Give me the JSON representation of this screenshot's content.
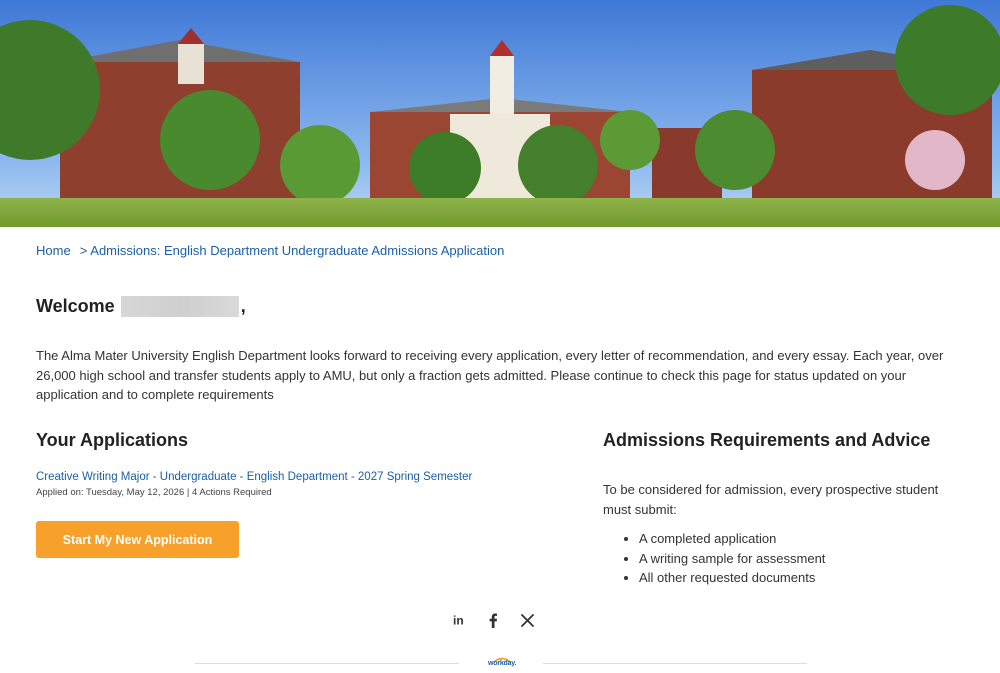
{
  "hero": {
    "image_alt": "campus-buildings-photo"
  },
  "breadcrumb": {
    "home": "Home",
    "separator": ">",
    "current": "Admissions: English Department Undergraduate Admissions Application"
  },
  "welcome": {
    "prefix": "Welcome",
    "suffix": ","
  },
  "intro": "The Alma Mater University English Department looks forward to receiving every application, every letter of recommendation, and every essay. Each year, over 26,000 high school and transfer students apply to AMU, but only a fraction gets admitted. Please continue to check this page for status updated on your application and to complete requirements",
  "applications": {
    "title": "Your Applications",
    "items": [
      {
        "name": "Creative Writing Major - Undergraduate - English Department - 2027 Spring Semester",
        "meta": "Applied on: Tuesday, May 12, 2026 | 4 Actions Required"
      }
    ],
    "start_button": "Start My New Application"
  },
  "requirements": {
    "title": "Admissions Requirements and Advice",
    "intro": "To be considered for admission, every prospective student must submit:",
    "items": [
      "A completed application",
      "A writing sample for assessment",
      "All other requested documents"
    ]
  },
  "footer": {
    "social": [
      "linkedin-icon",
      "facebook-icon",
      "x-icon"
    ],
    "linkedin_glyph": "in",
    "logo_text": "workday."
  },
  "colors": {
    "link": "#1a5fa8",
    "accent_button": "#f7a12a"
  }
}
